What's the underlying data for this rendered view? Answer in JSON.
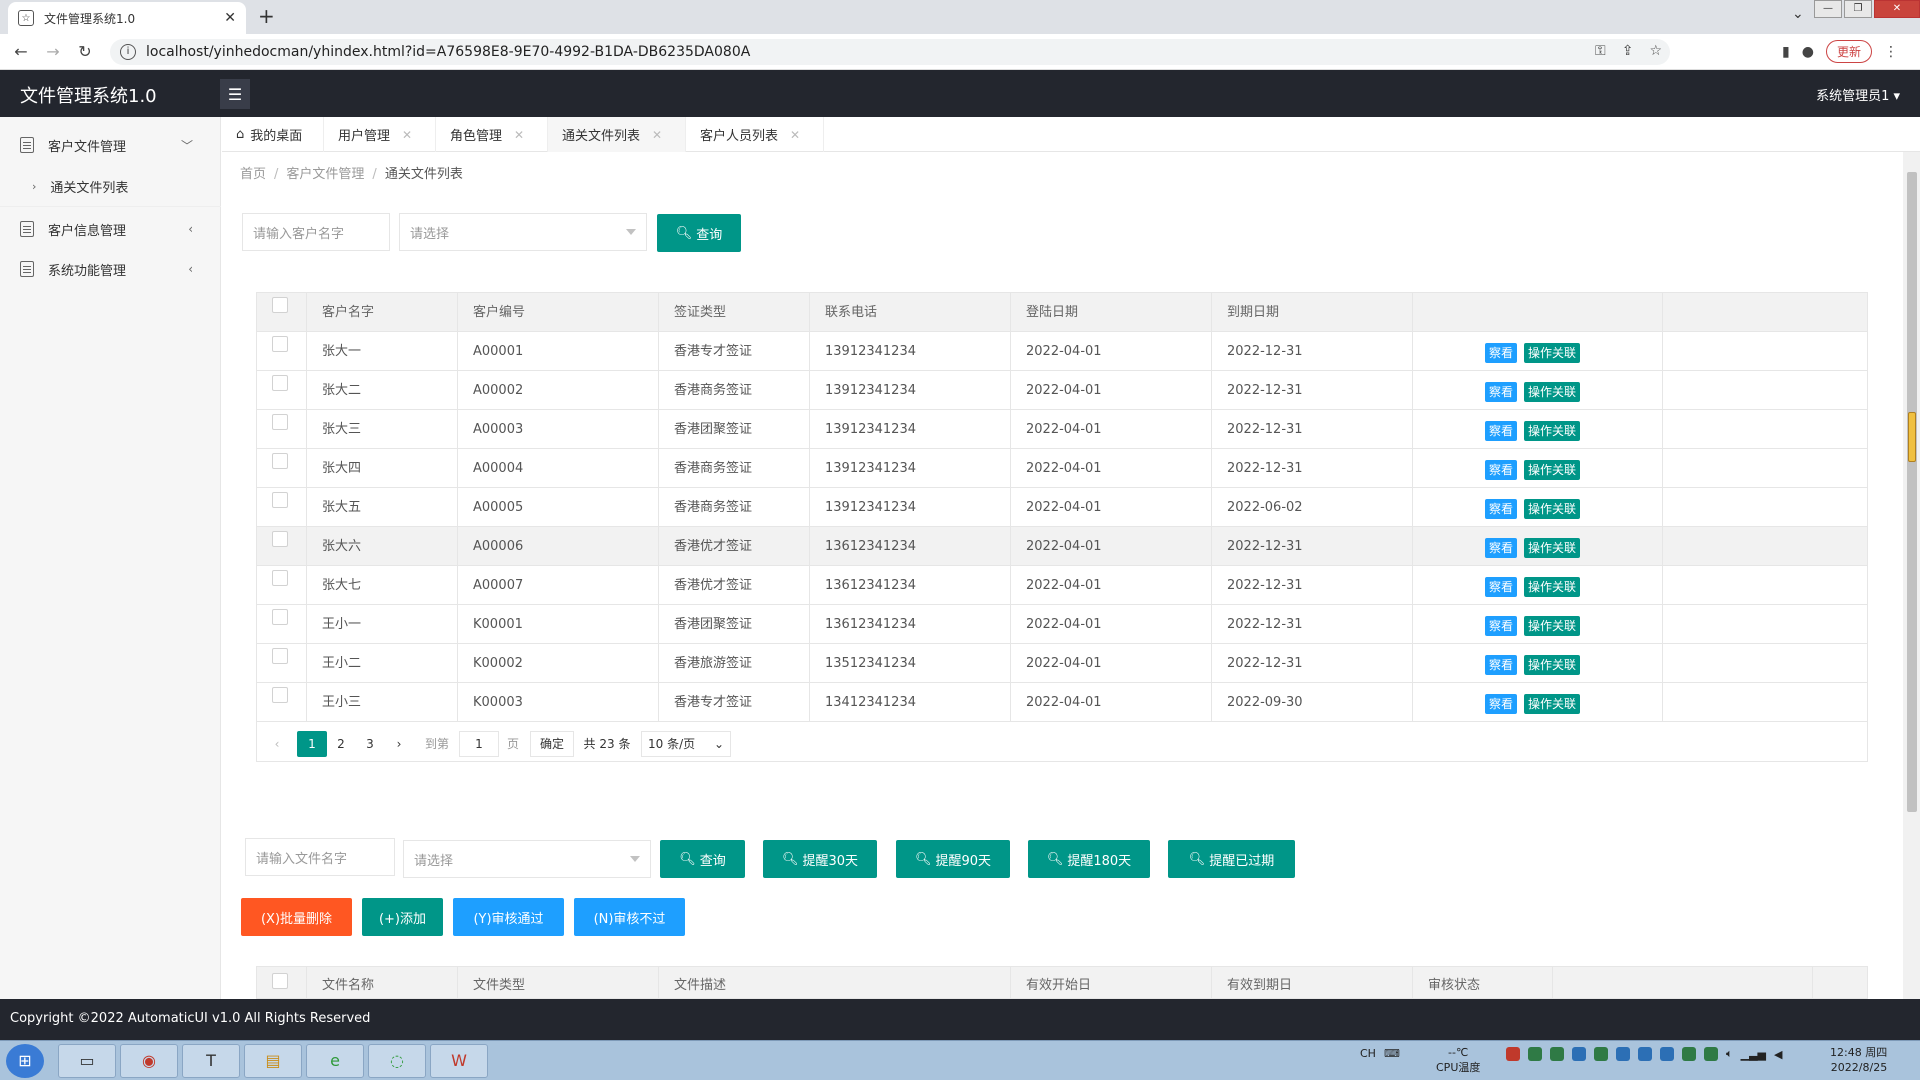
{
  "browser": {
    "tab_title": "文件管理系统1.0",
    "url": "localhost/yinhedocman/yhindex.html?id=A76598E8-9E70-4992-B1DA-DB6235DA080A",
    "update_label": "更新"
  },
  "header": {
    "title": "文件管理系统1.0",
    "user": "系统管理员1 ▾"
  },
  "sidebar": {
    "items": [
      {
        "label": "客户文件管理",
        "arrow": "﹀"
      },
      {
        "label": "客户信息管理",
        "arrow": "‹"
      },
      {
        "label": "系统功能管理",
        "arrow": "‹"
      }
    ],
    "sub_items": [
      {
        "label": "通关文件列表"
      }
    ]
  },
  "content_tabs": [
    {
      "label": "我的桌面"
    },
    {
      "label": "用户管理"
    },
    {
      "label": "角色管理"
    },
    {
      "label": "通关文件列表"
    },
    {
      "label": "客户人员列表"
    }
  ],
  "breadcrumb": [
    "首页",
    "客户文件管理",
    "通关文件列表"
  ],
  "search1": {
    "name_placeholder": "请输入客户名字",
    "select_placeholder": "请选择",
    "query_label": "查询"
  },
  "customer_table": {
    "headers": [
      "客户名字",
      "客户编号",
      "签证类型",
      "联系电话",
      "登陆日期",
      "到期日期"
    ],
    "rows": [
      {
        "name": "张大一",
        "code": "A00001",
        "visa": "香港专才签证",
        "phone": "13912341234",
        "login": "2022-04-01",
        "expire": "2022-12-31"
      },
      {
        "name": "张大二",
        "code": "A00002",
        "visa": "香港商务签证",
        "phone": "13912341234",
        "login": "2022-04-01",
        "expire": "2022-12-31"
      },
      {
        "name": "张大三",
        "code": "A00003",
        "visa": "香港团聚签证",
        "phone": "13912341234",
        "login": "2022-04-01",
        "expire": "2022-12-31"
      },
      {
        "name": "张大四",
        "code": "A00004",
        "visa": "香港商务签证",
        "phone": "13912341234",
        "login": "2022-04-01",
        "expire": "2022-12-31"
      },
      {
        "name": "张大五",
        "code": "A00005",
        "visa": "香港商务签证",
        "phone": "13912341234",
        "login": "2022-04-01",
        "expire": "2022-06-02"
      },
      {
        "name": "张大六",
        "code": "A00006",
        "visa": "香港优才签证",
        "phone": "13612341234",
        "login": "2022-04-01",
        "expire": "2022-12-31"
      },
      {
        "name": "张大七",
        "code": "A00007",
        "visa": "香港优才签证",
        "phone": "13612341234",
        "login": "2022-04-01",
        "expire": "2022-12-31"
      },
      {
        "name": "王小一",
        "code": "K00001",
        "visa": "香港团聚签证",
        "phone": "13612341234",
        "login": "2022-04-01",
        "expire": "2022-12-31"
      },
      {
        "name": "王小二",
        "code": "K00002",
        "visa": "香港旅游签证",
        "phone": "13512341234",
        "login": "2022-04-01",
        "expire": "2022-12-31"
      },
      {
        "name": "王小三",
        "code": "K00003",
        "visa": "香港专才签证",
        "phone": "13412341234",
        "login": "2022-04-01",
        "expire": "2022-09-30"
      }
    ],
    "view_label": "察看",
    "op_label": "操作关联"
  },
  "pager": {
    "pages": [
      "1",
      "2",
      "3"
    ],
    "goto_label": "到第",
    "goto_value": "1",
    "page_unit": "页",
    "confirm_label": "确定",
    "total": "共 23 条",
    "per_page": "10 条/页"
  },
  "search2": {
    "name_placeholder": "请输入文件名字",
    "select_placeholder": "请选择",
    "query_label": "查询",
    "r30": "提醒30天",
    "r90": "提醒90天",
    "r180": "提醒180天",
    "rexp": "提醒已过期"
  },
  "actions": {
    "batch_delete": "(X)批量删除",
    "add": "(+)添加",
    "approve": "(Y)审核通过",
    "reject": "(N)审核不过"
  },
  "file_table": {
    "headers": [
      "文件名称",
      "文件类型",
      "文件描述",
      "有效开始日",
      "有效到期日",
      "审核状态"
    ]
  },
  "footer": "Copyright ©2022 AutomaticUI v1.0 All Rights Reserved",
  "taskbar": {
    "cpu_line1": "--℃",
    "cpu_line2": "CPU温度",
    "ime": "CH",
    "time": "12:48 周四",
    "date": "2022/8/25"
  },
  "colors": {
    "primary": "#009688",
    "danger": "#ff5722",
    "info": "#1e9fff",
    "header_bg": "#23262e"
  }
}
